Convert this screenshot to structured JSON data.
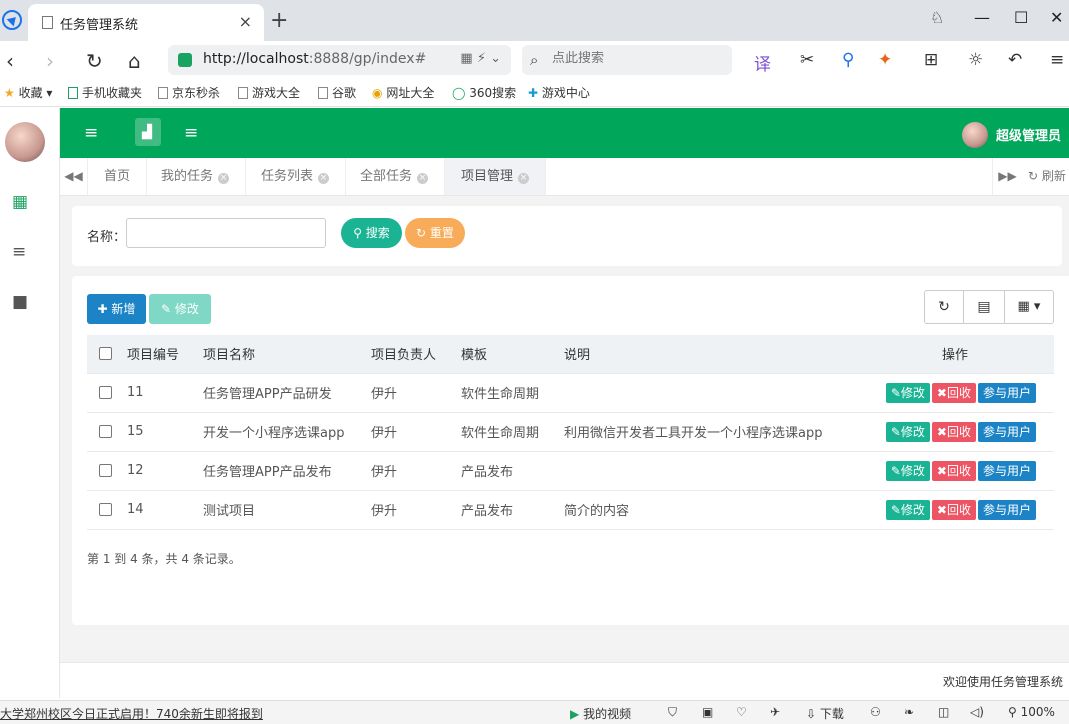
{
  "browser": {
    "tab_title": "任务管理系统",
    "url_host": "http://localhost",
    "url_path": ":8888/gp/index#",
    "search_placeholder": "点此搜索"
  },
  "bookmarks": [
    "收藏",
    "手机收藏夹",
    "京东秒杀",
    "游戏大全",
    "谷歌",
    "网址大全",
    "360搜索",
    "游戏中心"
  ],
  "header": {
    "username": "超级管理员"
  },
  "tabs": {
    "items": [
      "首页",
      "我的任务",
      "任务列表",
      "全部任务",
      "项目管理"
    ],
    "refresh": "刷新"
  },
  "search": {
    "name_label": "名称：",
    "name_value": "",
    "search_btn": "搜索",
    "reset_btn": "重置"
  },
  "toolbar": {
    "add": "新增",
    "edit": "修改"
  },
  "table": {
    "columns": [
      "项目编号",
      "项目名称",
      "项目负责人",
      "模板",
      "说明",
      "操作"
    ],
    "rows": [
      {
        "id": "11",
        "name": "任务管理APP产品研发",
        "owner": "伊升",
        "template": "软件生命周期",
        "desc": ""
      },
      {
        "id": "15",
        "name": "开发一个小程序选课app",
        "owner": "伊升",
        "template": "软件生命周期",
        "desc": "利用微信开发者工具开发一个小程序选课app"
      },
      {
        "id": "12",
        "name": "任务管理APP产品发布",
        "owner": "伊升",
        "template": "产品发布",
        "desc": ""
      },
      {
        "id": "14",
        "name": "测试项目",
        "owner": "伊升",
        "template": "产品发布",
        "desc": "简介的内容"
      }
    ],
    "actions": {
      "edit": "修改",
      "recycle": "回收",
      "members": "参与用户"
    }
  },
  "summary": "第 1 到 4 条，共 4 条记录。",
  "footer": "欢迎使用任务管理系统",
  "statusbar": {
    "news": "大学郑州校区今日正式启用！740余新生即将报到",
    "video": "我的视频",
    "download": "下载",
    "zoom": "100%"
  },
  "colors": {
    "header": "#00a65a",
    "primary": "#1c84c6",
    "success": "#1ab394",
    "danger": "#ed5565",
    "warning": "#f8ac59"
  }
}
